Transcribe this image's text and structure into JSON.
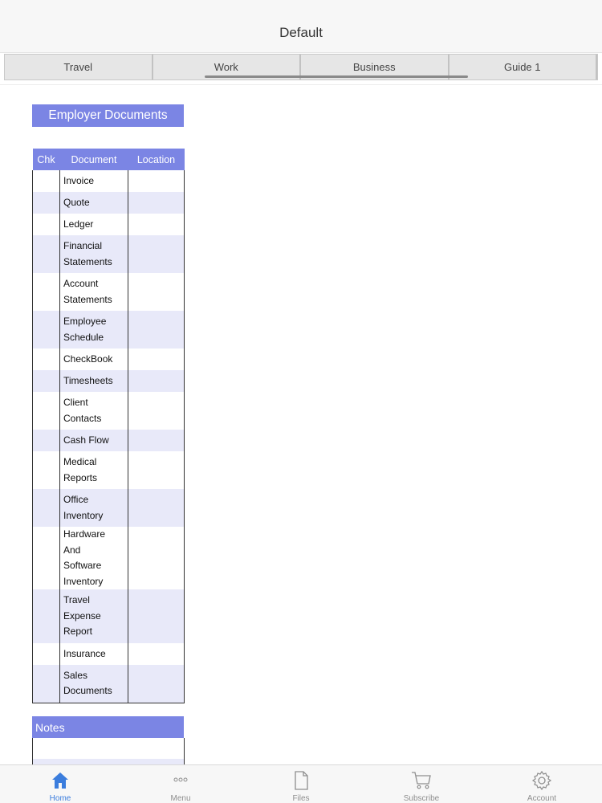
{
  "title": "Default",
  "tabs": [
    "Travel",
    "Work",
    "Business",
    "Guide 1"
  ],
  "section_title": "Employer Documents",
  "table": {
    "headers": {
      "chk": "Chk",
      "document": "Document",
      "location": "Location"
    },
    "rows": [
      {
        "doc": "Invoice"
      },
      {
        "doc": "Quote"
      },
      {
        "doc": "Ledger"
      },
      {
        "doc": "Financial\nStatements"
      },
      {
        "doc": "Account\nStatements"
      },
      {
        "doc": "Employee\nSchedule"
      },
      {
        "doc": "CheckBook"
      },
      {
        "doc": "Timesheets"
      },
      {
        "doc": "Client\nContacts"
      },
      {
        "doc": "Cash Flow"
      },
      {
        "doc": "Medical\nReports"
      },
      {
        "doc": "Office\nInventory"
      },
      {
        "doc": "Hardware And\nSoftware\nInventory"
      },
      {
        "doc": "Travel\nExpense\nReport"
      },
      {
        "doc": "Insurance"
      },
      {
        "doc": "Sales\nDocuments"
      }
    ]
  },
  "notes_title": "Notes",
  "bottom_nav": [
    {
      "label": "Home",
      "icon": "home-icon",
      "active": true
    },
    {
      "label": "Menu",
      "icon": "more-dots-icon",
      "active": false
    },
    {
      "label": "Files",
      "icon": "file-icon",
      "active": false
    },
    {
      "label": "Subscribe",
      "icon": "cart-icon",
      "active": false
    },
    {
      "label": "Account",
      "icon": "gear-icon",
      "active": false
    }
  ],
  "colors": {
    "accent": "#7b85e4",
    "stripe": "#e8e9f9",
    "nav_active": "#3b7ddd",
    "nav_inactive": "#8e8e8e"
  }
}
